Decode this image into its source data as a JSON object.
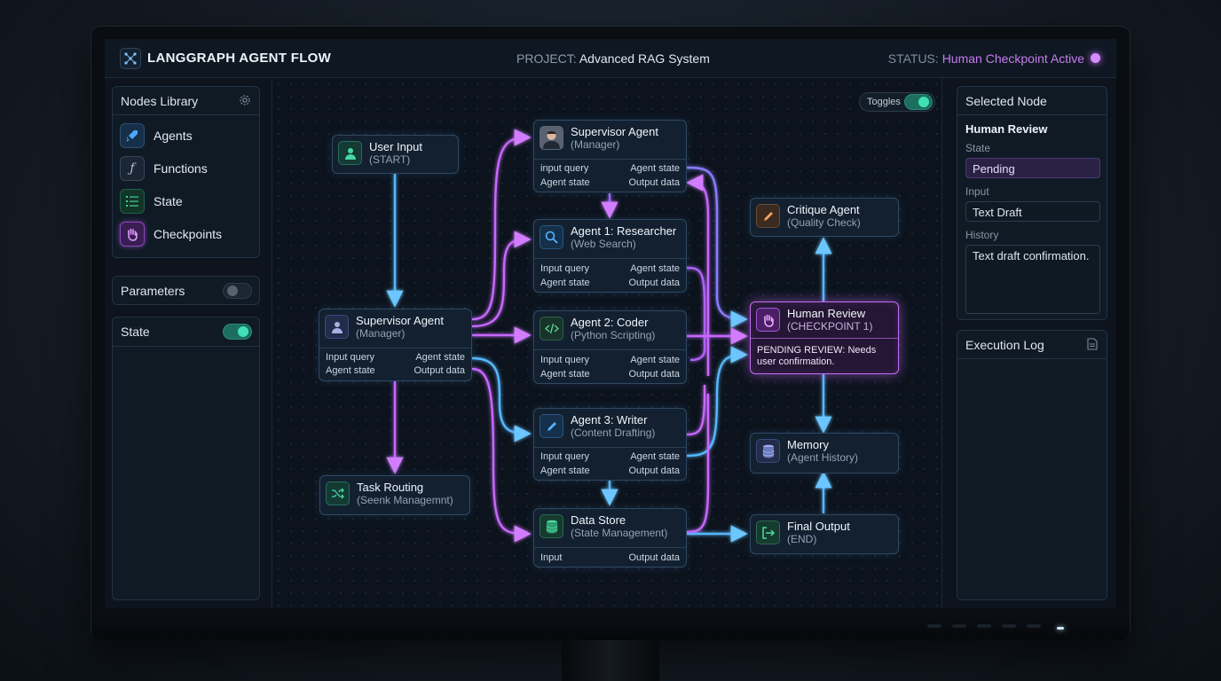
{
  "header": {
    "title": "LANGGRAPH AGENT FLOW",
    "project_label": "PROJECT:",
    "project_name": "Advanced RAG System",
    "status_label": "STATUS:",
    "status_value": "Human Checkpoint Active",
    "status_color": "#d68cff"
  },
  "left_panel": {
    "library_title": "Nodes Library",
    "library_items": [
      {
        "label": "Agents",
        "icon": "rocket-icon",
        "color": "#4aa8ff"
      },
      {
        "label": "Functions",
        "icon": "function-icon",
        "color": "#9aa6b4"
      },
      {
        "label": "State",
        "icon": "list-icon",
        "color": "#3fd49b"
      },
      {
        "label": "Checkpoints",
        "icon": "hand-icon",
        "color": "#d274ff"
      }
    ],
    "parameters_label": "Parameters",
    "parameters_on": false,
    "state_label": "State",
    "state_on": true
  },
  "canvas": {
    "toggles_label": "Toggles",
    "toggles_on": true,
    "nodes": {
      "user_input": {
        "title": "User Input",
        "sub": "(START)"
      },
      "supervisor_main": {
        "title": "Supervisor Agent",
        "sub": "(Manager)",
        "p1": "Input query",
        "p2": "Agent state",
        "p3": "Agent state",
        "p4": "Output data"
      },
      "task_routing": {
        "title": "Task Routing",
        "sub": "(Seenk Managemnt)"
      },
      "supervisor_top": {
        "title": "Supervisor Agent",
        "sub": "(Manager)",
        "p1": "input query",
        "p2": "Agent state",
        "p3": "Agent state",
        "p4": "Output data"
      },
      "researcher": {
        "title": "Agent 1: Researcher",
        "sub": "(Web Search)",
        "p1": "Input query",
        "p2": "Agent state",
        "p3": "Agent state",
        "p4": "Output data"
      },
      "coder": {
        "title": "Agent 2: Coder",
        "sub": "(Python Scripting)",
        "p1": "Input query",
        "p2": "Agent state",
        "p3": "Agent state",
        "p4": "Output data"
      },
      "writer": {
        "title": "Agent 3: Writer",
        "sub": "(Content Drafting)",
        "p1": "Input query",
        "p2": "Agent state",
        "p3": "Agent state",
        "p4": "Output data"
      },
      "data_store": {
        "title": "Data Store",
        "sub": "(State Management)",
        "p1": "Input",
        "p2": "Output data"
      },
      "critique": {
        "title": "Critique Agent",
        "sub": "(Quality Check)"
      },
      "human_review": {
        "title": "Human Review",
        "sub": "(CHECKPOINT 1)",
        "note": "PENDING REVIEW: Needs user confirmation."
      },
      "memory": {
        "title": "Memory",
        "sub": "(Agent History)"
      },
      "final_output": {
        "title": "Final Output",
        "sub": "(END)"
      }
    }
  },
  "right_panel": {
    "selected_title": "Selected Node",
    "node_name": "Human Review",
    "state_label": "State",
    "state_value": "Pending",
    "input_label": "Input",
    "input_value": "Text Draft",
    "history_label": "History",
    "history_value": "Text draft confirmation.",
    "log_title": "Execution Log"
  },
  "colors": {
    "blue_wire": "#58b8ff",
    "purple_wire": "#c868ff",
    "accent_green": "#42e0b5"
  }
}
